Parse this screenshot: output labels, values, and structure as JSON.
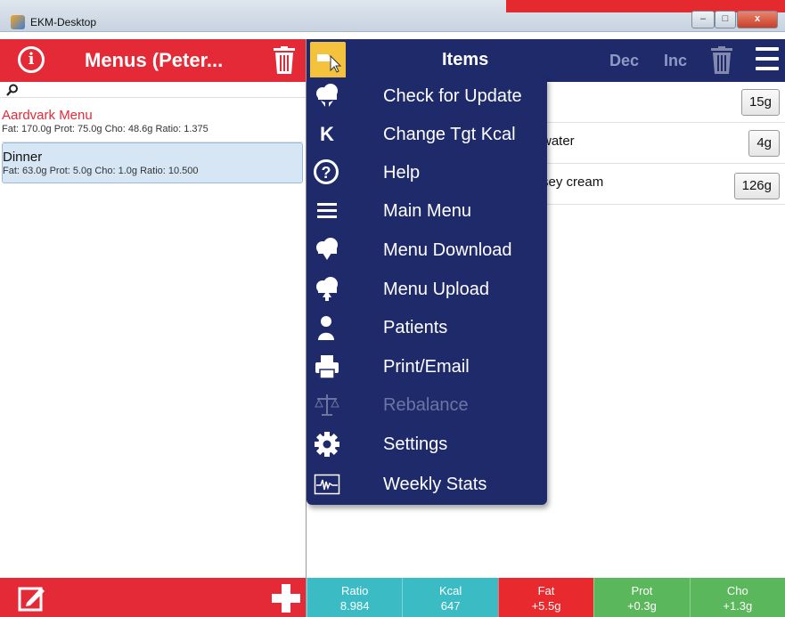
{
  "window": {
    "title": "EKM-Desktop",
    "controls": {
      "minimize": "–",
      "maximize": "□",
      "close": "x"
    }
  },
  "left": {
    "title": "Menus (Peter...",
    "search_placeholder": "",
    "menus": [
      {
        "name": "Aardvark Menu",
        "stats": "Fat: 170.0g Prot: 75.0g Cho: 48.6g Ratio: 1.375"
      },
      {
        "name": "Dinner",
        "stats": "Fat: 63.0g Prot: 5.0g Cho: 1.0g Ratio: 10.500"
      }
    ]
  },
  "right": {
    "title": "Items",
    "dec_label": "Dec",
    "inc_label": "Inc",
    "items": [
      {
        "name": "",
        "qty": "15g"
      },
      {
        "name": "water",
        "qty": "4g"
      },
      {
        "name": "sey cream",
        "qty": "126g"
      }
    ],
    "stats": [
      {
        "label": "Ratio",
        "value": "8.984"
      },
      {
        "label": "Kcal",
        "value": "647"
      },
      {
        "label": "Fat",
        "value": "+5.5g"
      },
      {
        "label": "Prot",
        "value": "+0.3g"
      },
      {
        "label": "Cho",
        "value": "+1.3g"
      }
    ]
  },
  "dropdown": {
    "items": [
      {
        "label": "Check for Update",
        "icon": "cloud-arrows-icon"
      },
      {
        "label": "Change Tgt Kcal",
        "icon": "letter-k-icon",
        "glyph": "K"
      },
      {
        "label": "Help",
        "icon": "help-icon",
        "glyph": "?"
      },
      {
        "label": "Main Menu",
        "icon": "hamburger-icon"
      },
      {
        "label": "Menu Download",
        "icon": "cloud-download-icon"
      },
      {
        "label": "Menu Upload",
        "icon": "cloud-upload-icon"
      },
      {
        "label": "Patients",
        "icon": "person-icon"
      },
      {
        "label": "Print/Email",
        "icon": "printer-icon"
      },
      {
        "label": "Rebalance",
        "icon": "scales-icon",
        "disabled": true
      },
      {
        "label": "Settings",
        "icon": "gear-icon"
      },
      {
        "label": "Weekly Stats",
        "icon": "chart-icon"
      }
    ]
  },
  "colors": {
    "red": "#e52a37",
    "navy": "#1f2a6b",
    "teal": "#3bbcc5",
    "green": "#5bb75b",
    "yellow": "#f4c23d"
  }
}
